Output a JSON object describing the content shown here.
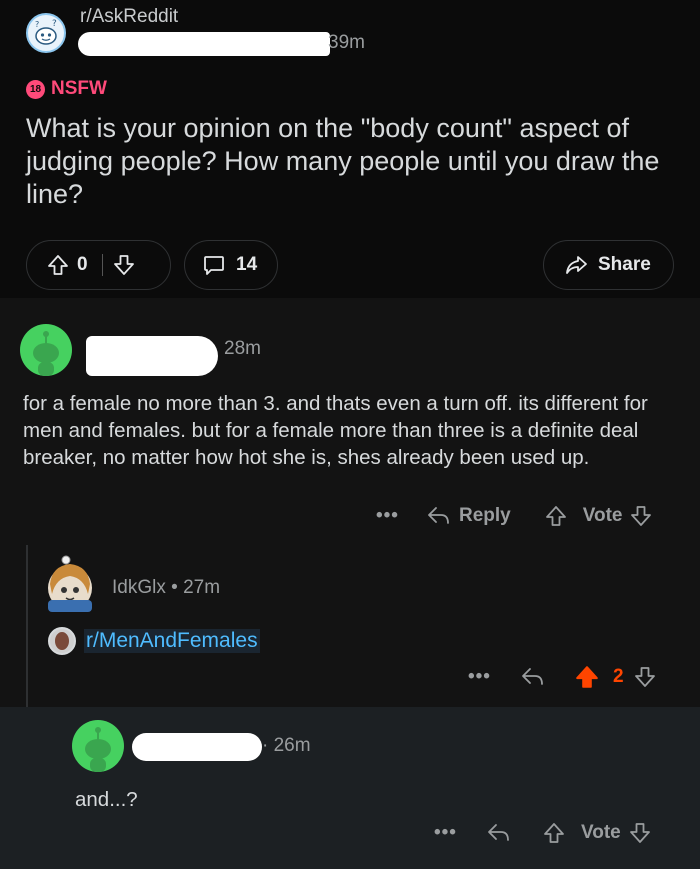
{
  "post": {
    "subreddit": "r/AskReddit",
    "time": "39m",
    "nsfw_label": "NSFW",
    "nsfw_badge": "18",
    "title": "What is your opinion on the \"body count\" aspect of judging people? How many people until you draw the line?",
    "score": "0",
    "comment_count": "14",
    "share_label": "Share"
  },
  "comments": [
    {
      "time": "28m",
      "text": "for a female no more than 3. and thats even a turn off. its different for men and females. but for a female more than three is a definite deal breaker, no matter how hot she is, shes already been used up.",
      "reply_label": "Reply",
      "vote_label": "Vote",
      "dots": "•••"
    },
    {
      "username": "IdkGlx",
      "separator": "•",
      "time": "27m",
      "link_text": "r/MenAndFemales",
      "score": "2",
      "dots": "•••"
    },
    {
      "time": "26m",
      "text": "and...?",
      "vote_label": "Vote",
      "dots": "•••"
    }
  ],
  "colors": {
    "nsfw": "#ff4a7a",
    "upvoted": "#ff4500",
    "link": "#4fbcff",
    "avatar_green": "#46d160"
  }
}
